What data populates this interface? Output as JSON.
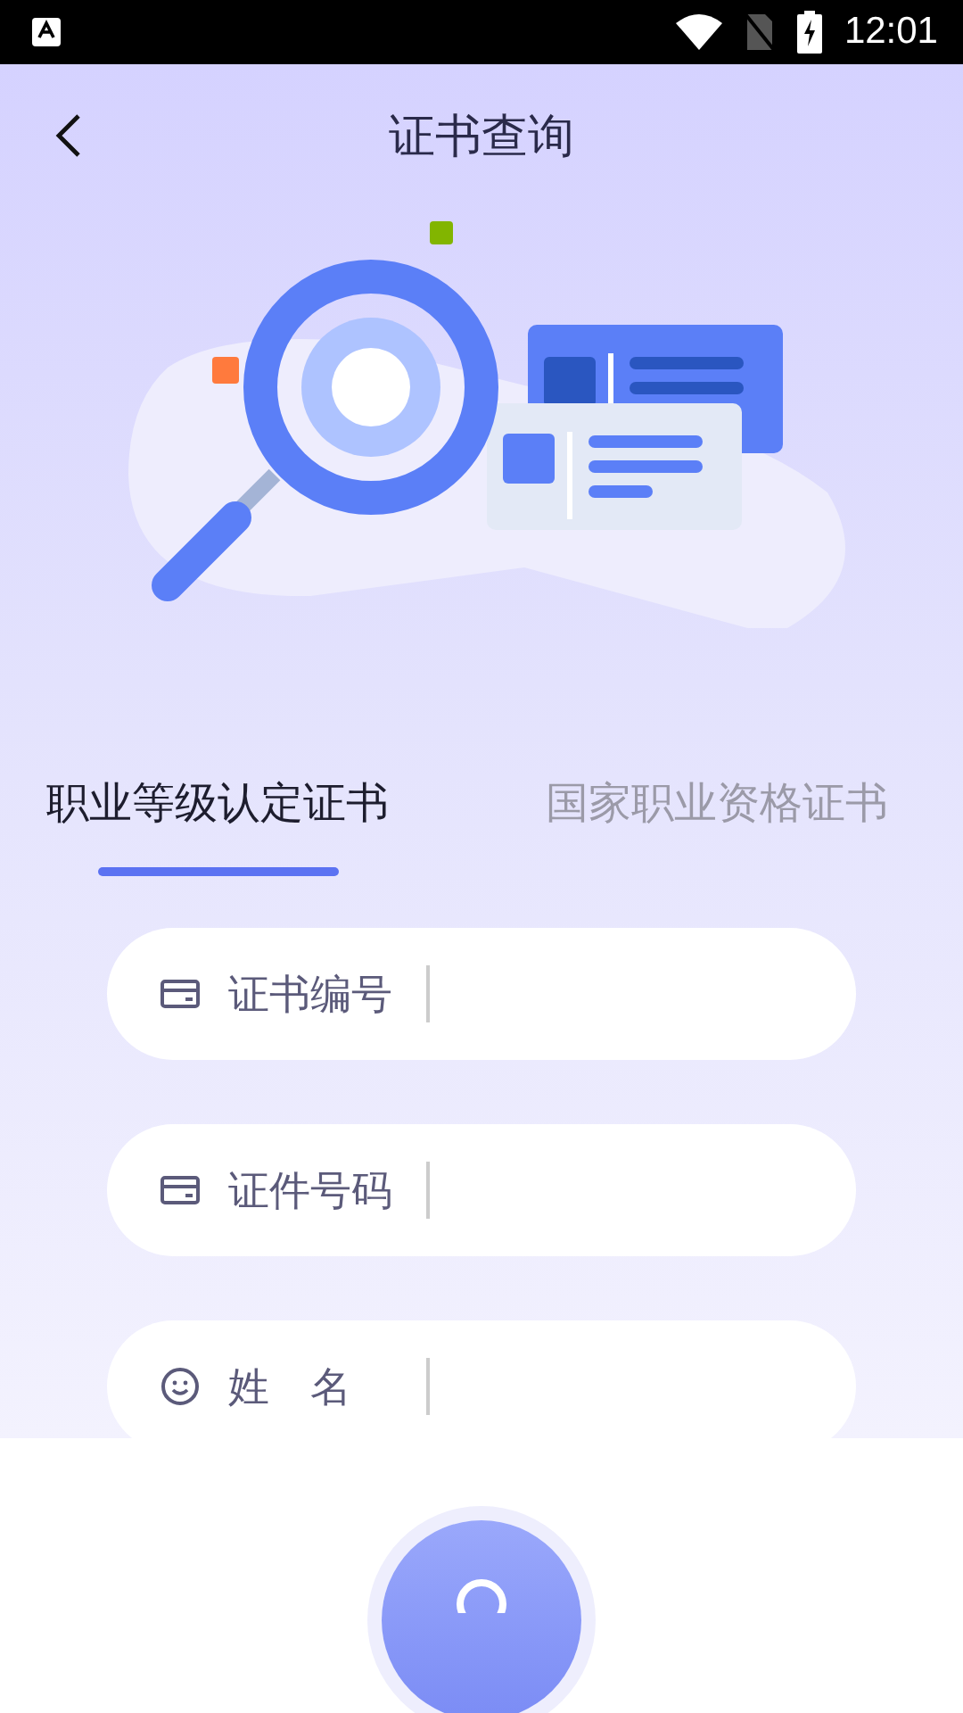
{
  "status_bar": {
    "time": "12:01"
  },
  "header": {
    "title": "证书查询"
  },
  "tabs": [
    {
      "label": "职业等级认定证书",
      "selected": true
    },
    {
      "label": "国家职业资格证书",
      "selected": false
    }
  ],
  "fields": [
    {
      "kind": "card",
      "label": "证书编号"
    },
    {
      "kind": "card",
      "label": "证件号码"
    },
    {
      "kind": "face",
      "label": "姓　名"
    }
  ]
}
